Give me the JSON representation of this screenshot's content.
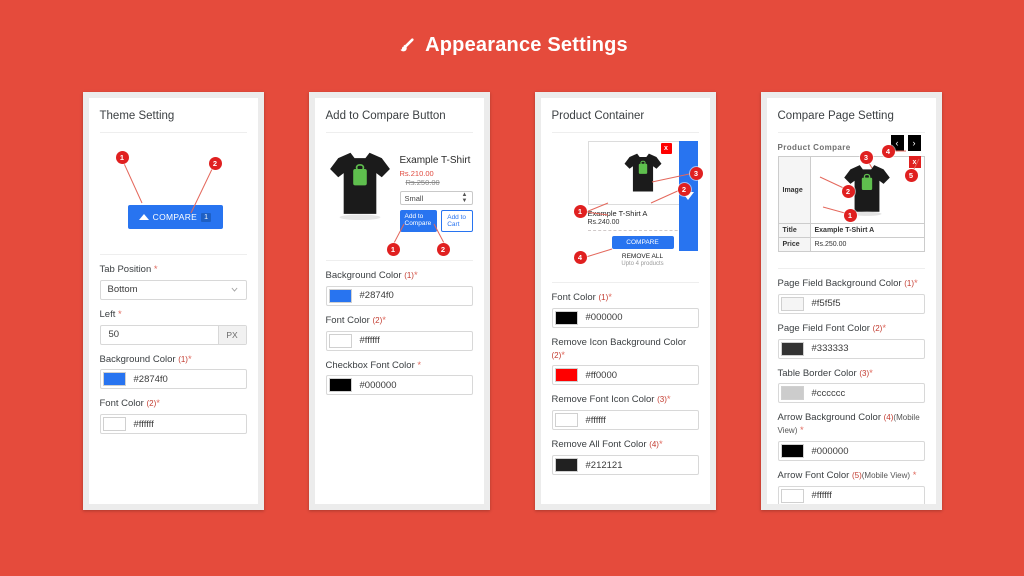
{
  "header": {
    "title": "Appearance Settings",
    "icon": "paint-brush-icon"
  },
  "theme": {
    "background": "#e54b3c",
    "card_bg": "#ffffff",
    "frame_bg": "#ececec",
    "accent_blue": "#2874f0",
    "marker_red": "#e02020"
  },
  "panels": [
    {
      "id": "theme-setting",
      "title": "Theme Setting",
      "preview": {
        "compare_button_label": "COMPARE",
        "compare_count": "1"
      },
      "markers": [
        "1",
        "2"
      ],
      "fields": [
        {
          "type": "select",
          "label": "Tab Position",
          "num": "",
          "required": true,
          "value": "Bottom"
        },
        {
          "type": "unit",
          "label": "Left",
          "num": "",
          "required": true,
          "value": "50",
          "unit": "PX"
        },
        {
          "type": "color",
          "label": "Background Color",
          "num": "(1)",
          "required": true,
          "value": "#2874f0",
          "swatch": "#2874f0"
        },
        {
          "type": "color",
          "label": "Font Color",
          "num": "(2)",
          "required": true,
          "value": "#ffffff",
          "swatch": "#ffffff"
        }
      ]
    },
    {
      "id": "add-to-compare-button",
      "title": "Add to Compare Button",
      "preview": {
        "product_name": "Example T-Shirt",
        "price_sale": "Rs.210.00",
        "price_old": "Rs.250.00",
        "variant": "Small",
        "btn_compare": "Add to Compare",
        "btn_cart": "Add to Cart"
      },
      "markers": [
        "1",
        "2"
      ],
      "fields": [
        {
          "type": "color",
          "label": "Background Color",
          "num": "(1)",
          "required": true,
          "value": "#2874f0",
          "swatch": "#2874f0"
        },
        {
          "type": "color",
          "label": "Font Color",
          "num": "(2)",
          "required": true,
          "value": "#ffffff",
          "swatch": "#ffffff"
        },
        {
          "type": "color",
          "label": "Checkbox Font Color",
          "num": "",
          "required": true,
          "value": "#000000",
          "swatch": "#000000"
        }
      ]
    },
    {
      "id": "product-container",
      "title": "Product Container",
      "preview": {
        "product_name": "Example T-Shirt A",
        "price": "Rs.240.00",
        "compare_label": "COMPARE",
        "remove_all_label": "REMOVE ALL",
        "upto_label": "Upto 4 products",
        "close_glyph": "x"
      },
      "markers": [
        "1",
        "2",
        "3",
        "4"
      ],
      "fields": [
        {
          "type": "color",
          "label": "Font Color",
          "num": "(1)",
          "required": true,
          "value": "#000000",
          "swatch": "#000000"
        },
        {
          "type": "color",
          "label": "Remove Icon Background Color",
          "num": "(2)",
          "required": true,
          "value": "#ff0000",
          "swatch": "#ff0000"
        },
        {
          "type": "color",
          "label": "Remove Font Icon Color",
          "num": "(3)",
          "required": true,
          "value": "#ffffff",
          "swatch": "#ffffff"
        },
        {
          "type": "color",
          "label": "Remove All Font Color",
          "num": "(4)",
          "required": true,
          "value": "#212121",
          "swatch": "#212121"
        }
      ]
    },
    {
      "id": "compare-page-setting",
      "title": "Compare Page Setting",
      "preview": {
        "heading": "Product Compare",
        "row_image_label": "Image",
        "row_title_label": "Title",
        "row_title_value": "Example T-Shirt A",
        "row_price_label": "Price",
        "row_price_value": "Rs.250.00",
        "arrow_prev": "‹",
        "arrow_next": "›",
        "close_glyph": "x"
      },
      "markers": [
        "1",
        "2",
        "3",
        "4",
        "5"
      ],
      "fields": [
        {
          "type": "color",
          "label": "Page Field Background Color",
          "num": "(1)",
          "required": true,
          "value": "#f5f5f5",
          "swatch": "#f5f5f5"
        },
        {
          "type": "color",
          "label": "Page Field Font Color",
          "num": "(2)",
          "required": true,
          "value": "#333333",
          "swatch": "#333333"
        },
        {
          "type": "color",
          "label": "Table Border Color",
          "num": "(3)",
          "required": true,
          "value": "#cccccc",
          "swatch": "#cccccc"
        },
        {
          "type": "color",
          "label": "Arrow Background Color",
          "num": "(4)",
          "mobile": "(Mobile View)",
          "required": true,
          "value": "#000000",
          "swatch": "#000000"
        },
        {
          "type": "color",
          "label": "Arrow Font Color",
          "num": "(5)",
          "mobile": "(Mobile View)",
          "required": true,
          "value": "#ffffff",
          "swatch": "#ffffff"
        }
      ]
    }
  ]
}
